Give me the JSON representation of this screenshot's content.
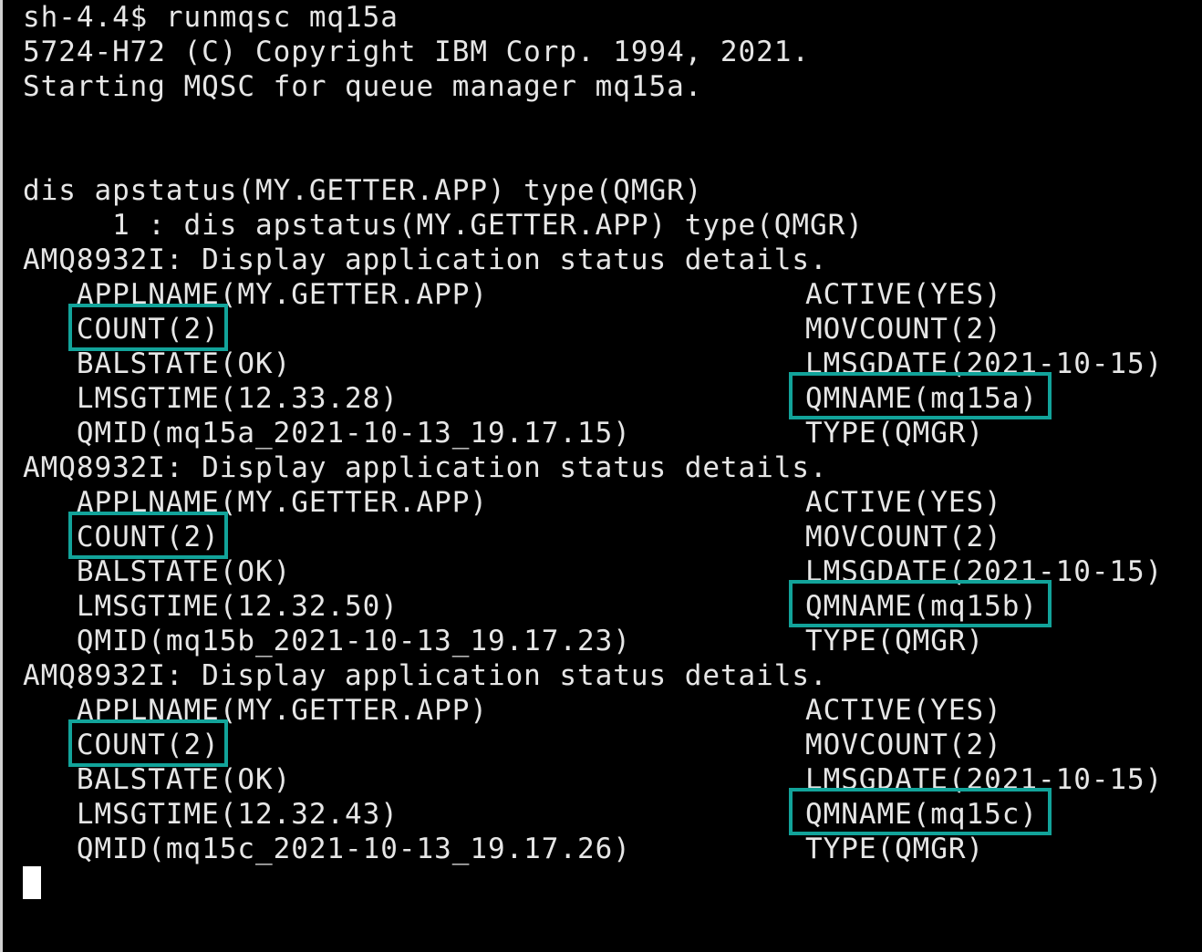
{
  "terminal": {
    "header": [
      "sh-4.4$ runmqsc mq15a",
      "5724-H72 (C) Copyright IBM Corp. 1994, 2021.",
      "Starting MQSC for queue manager mq15a."
    ],
    "command": "dis apstatus(MY.GETTER.APP) type(QMGR)",
    "echo": "     1 : dis apstatus(MY.GETTER.APP) type(QMGR)",
    "blocks": [
      {
        "msg": "AMQ8932I: Display application status details.",
        "rows": [
          {
            "left": "   APPLNAME(MY.GETTER.APP)",
            "right": "ACTIVE(YES)"
          },
          {
            "left": "   COUNT(2)",
            "right": "MOVCOUNT(2)"
          },
          {
            "left": "   BALSTATE(OK)",
            "right": "LMSGDATE(2021-10-15)"
          },
          {
            "left": "   LMSGTIME(12.33.28)",
            "right": "QMNAME(mq15a)"
          },
          {
            "left": "   QMID(mq15a_2021-10-13_19.17.15)",
            "right": "TYPE(QMGR)"
          }
        ]
      },
      {
        "msg": "AMQ8932I: Display application status details.",
        "rows": [
          {
            "left": "   APPLNAME(MY.GETTER.APP)",
            "right": "ACTIVE(YES)"
          },
          {
            "left": "   COUNT(2)",
            "right": "MOVCOUNT(2)"
          },
          {
            "left": "   BALSTATE(OK)",
            "right": "LMSGDATE(2021-10-15)"
          },
          {
            "left": "   LMSGTIME(12.32.50)",
            "right": "QMNAME(mq15b)"
          },
          {
            "left": "   QMID(mq15b_2021-10-13_19.17.23)",
            "right": "TYPE(QMGR)"
          }
        ]
      },
      {
        "msg": "AMQ8932I: Display application status details.",
        "rows": [
          {
            "left": "   APPLNAME(MY.GETTER.APP)",
            "right": "ACTIVE(YES)"
          },
          {
            "left": "   COUNT(2)",
            "right": "MOVCOUNT(2)"
          },
          {
            "left": "   BALSTATE(OK)",
            "right": "LMSGDATE(2021-10-15)"
          },
          {
            "left": "   LMSGTIME(12.32.43)",
            "right": "QMNAME(mq15c)"
          },
          {
            "left": "   QMID(mq15c_2021-10-13_19.17.26)",
            "right": "TYPE(QMGR)"
          }
        ]
      }
    ]
  },
  "colors": {
    "background": "#000000",
    "text": "#e6e6e6",
    "highlight": "#12a39a",
    "cursor": "#ffffff"
  }
}
